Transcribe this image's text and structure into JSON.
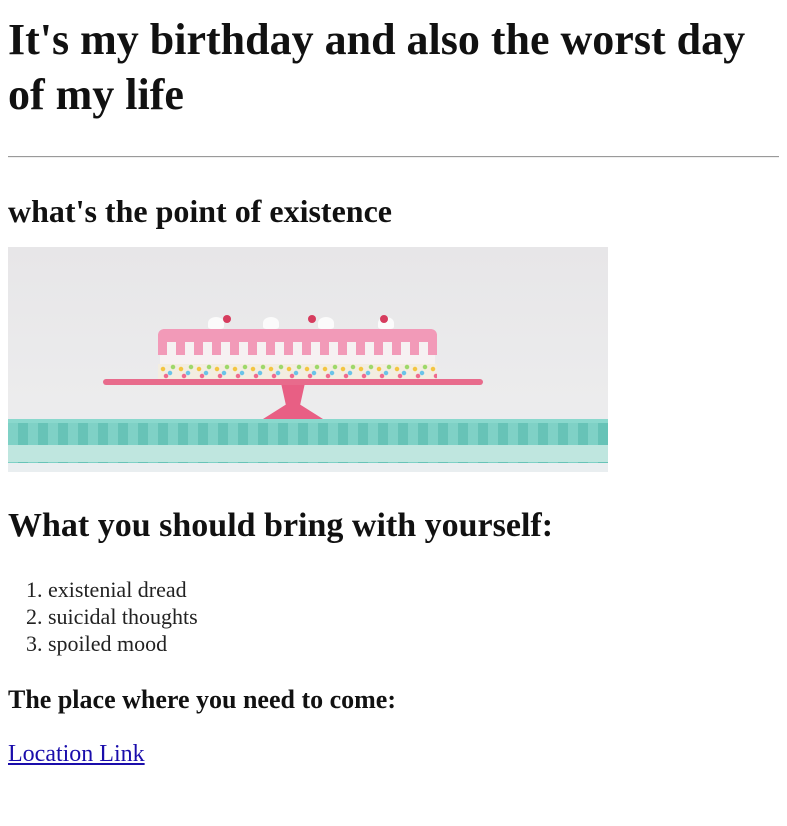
{
  "page": {
    "title": "It's my birthday and also the worst day of my life",
    "subtitle": "what's the point of existence",
    "image_alt": "birthday cake with pink drip frosting on a pink cake stand",
    "bring_heading": "What you should bring with yourself:",
    "bring_items": [
      "existenial dread",
      "suicidal thoughts",
      "spoiled mood"
    ],
    "place_heading": "The place where you need to come:",
    "location_link": "Location Link"
  }
}
